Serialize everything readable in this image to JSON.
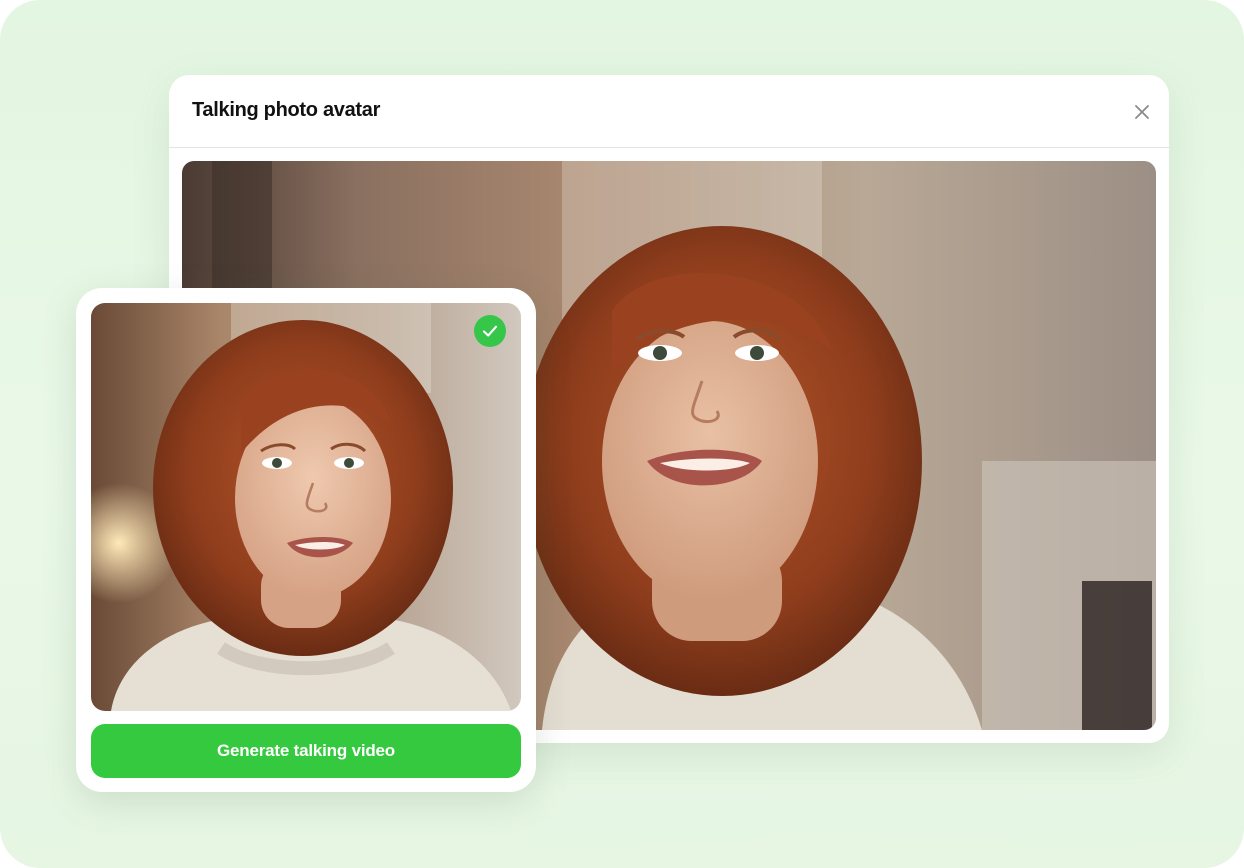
{
  "modal": {
    "title": "Talking photo avatar",
    "close_icon": "close-icon",
    "preview_image": "talking-avatar-preview-photo"
  },
  "upload_card": {
    "photo": "uploaded-portrait-photo",
    "status_icon": "check-icon",
    "generate_label": "Generate talking video"
  },
  "colors": {
    "background": "#e6f6e3",
    "accent": "#35c93f",
    "check": "#35c64a",
    "title": "#111111"
  }
}
